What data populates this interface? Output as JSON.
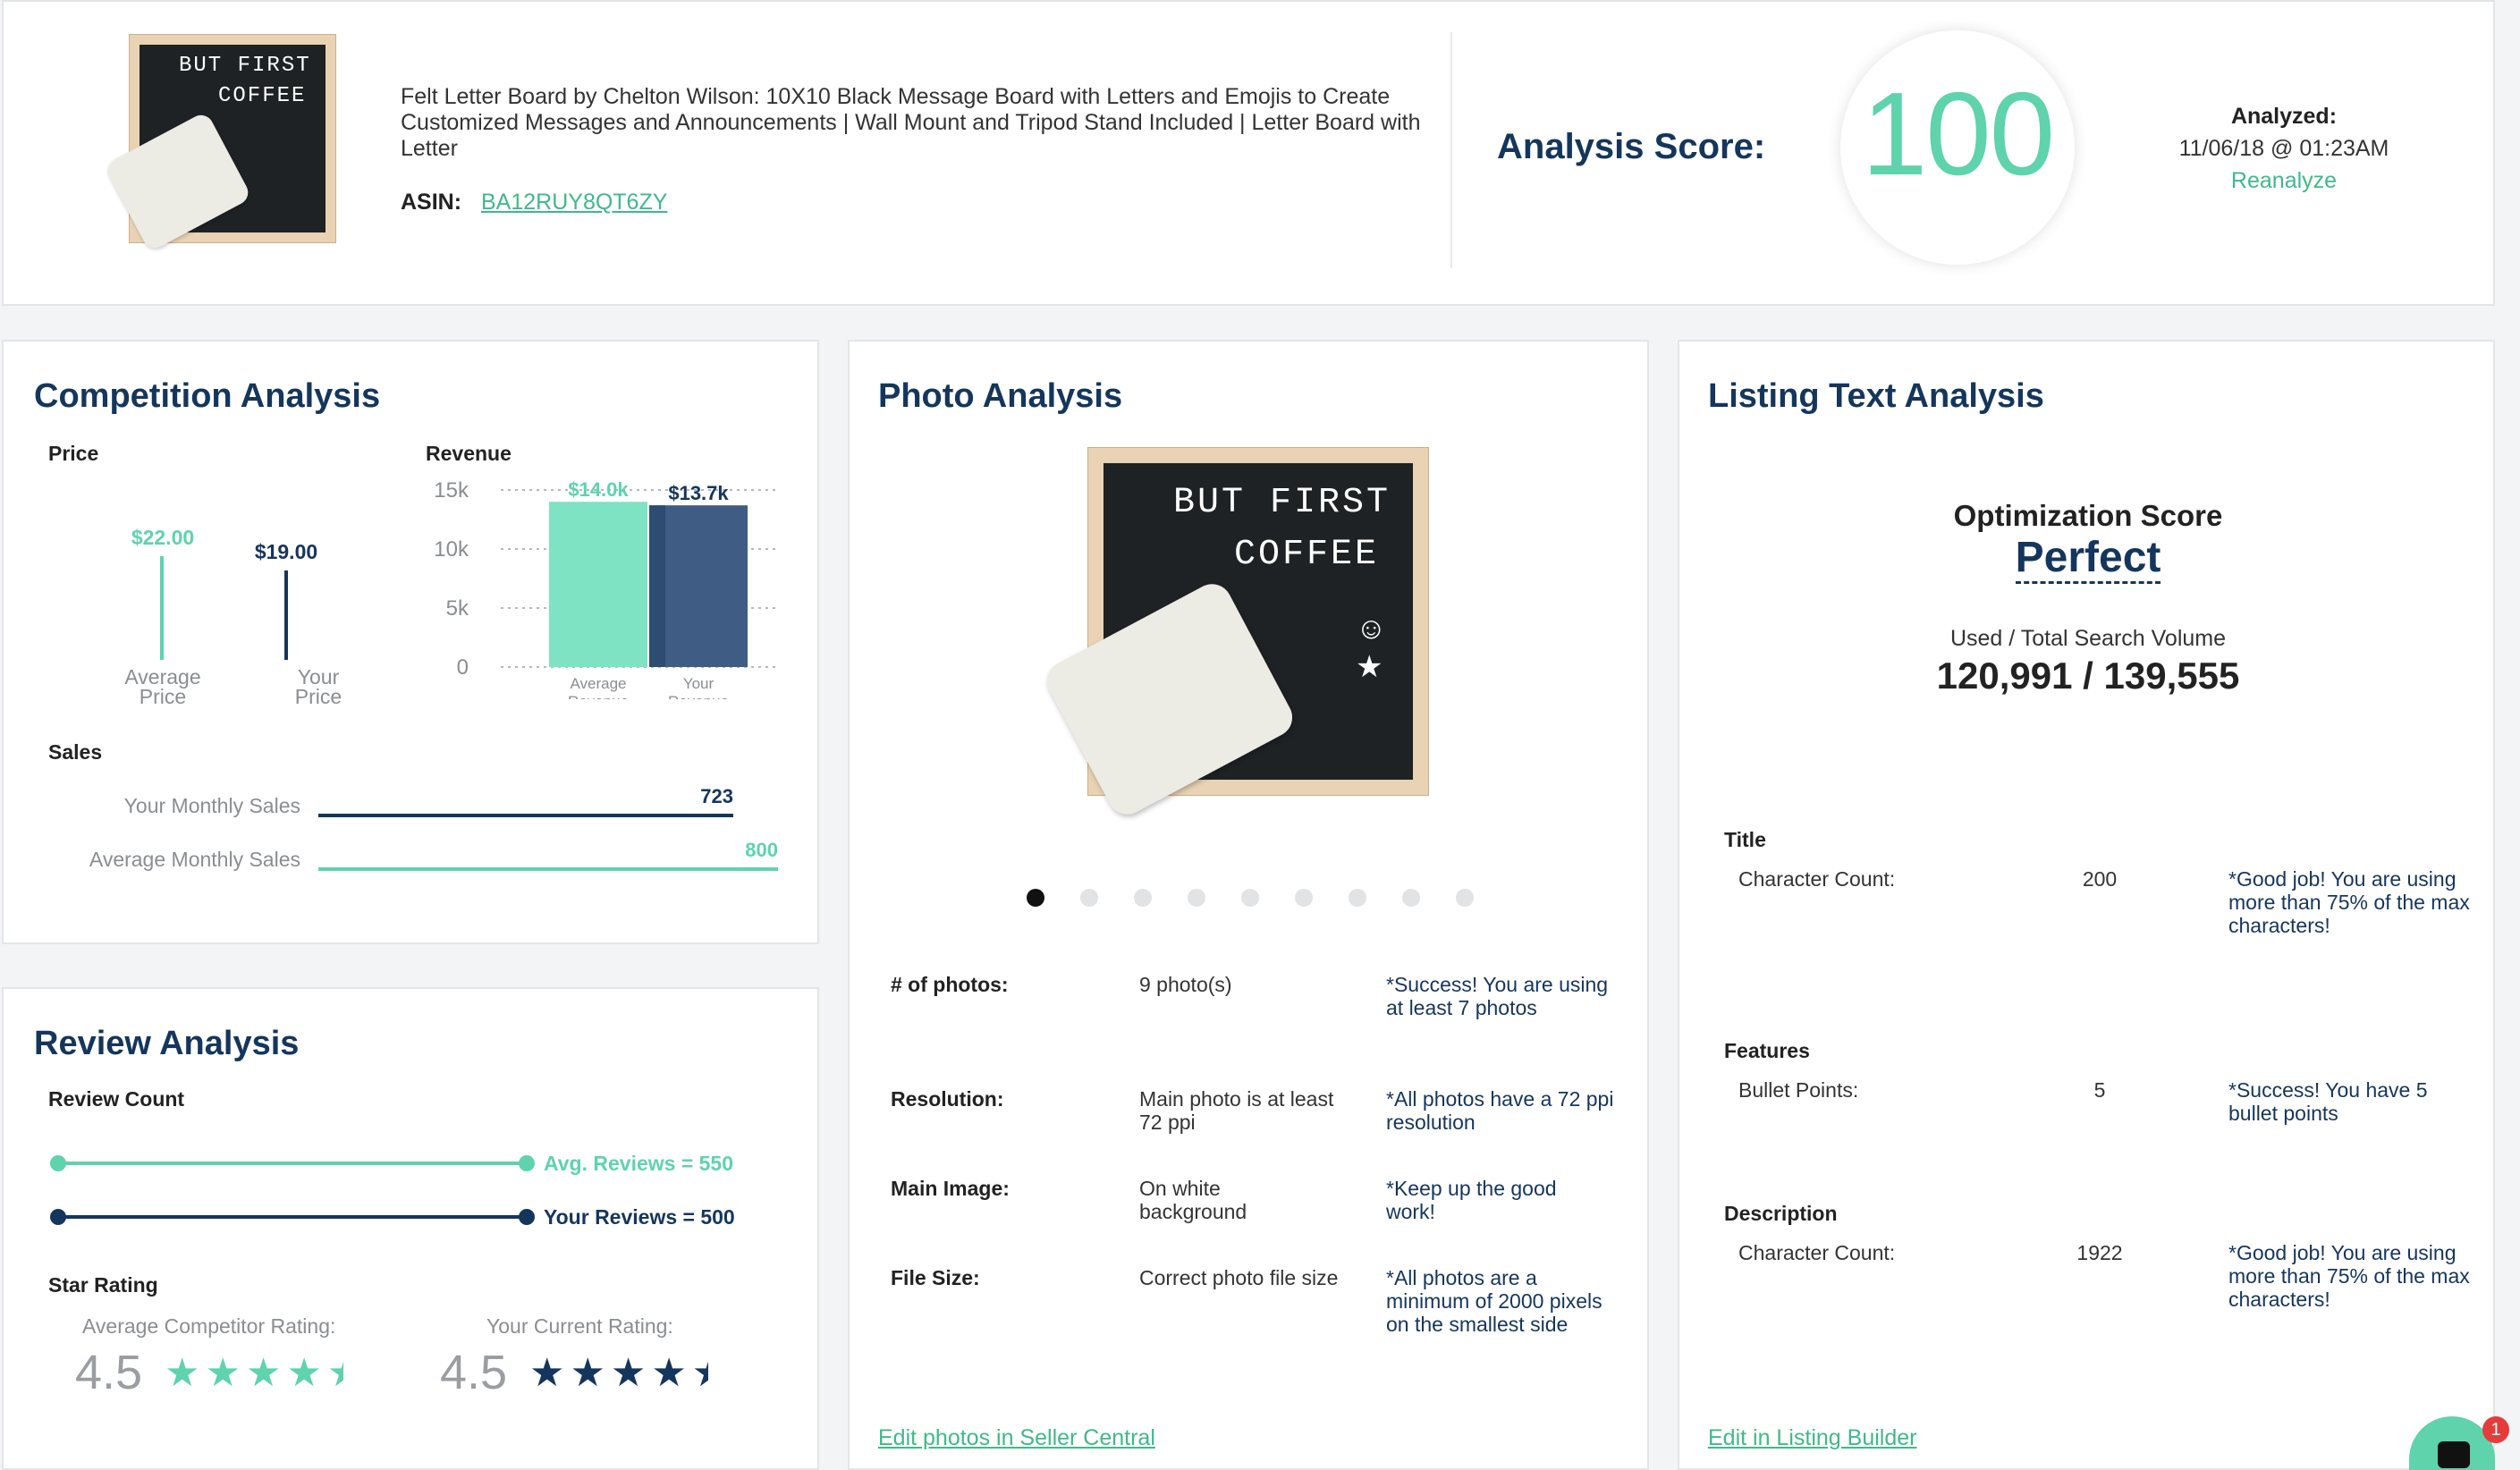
{
  "product": {
    "title": "Felt Letter Board by Chelton Wilson: 10X10 Black Message Board with Letters and Emojis to Create Customized Messages and Announcements | Wall Mount and Tripod Stand Included | Letter Board with Letter",
    "asin_label": "ASIN:",
    "asin": "BA12RUY8QT6ZY",
    "board_text_line1": "BUT FIRST",
    "board_text_line2": "COFFEE"
  },
  "score": {
    "label": "Analysis Score:",
    "value": "100",
    "analyzed_label": "Analyzed:",
    "analyzed_date": "11/06/18 @ 01:23AM",
    "reanalyze": "Reanalyze"
  },
  "competition": {
    "title": "Competition Analysis",
    "price_label": "Price",
    "avg_price_value": "$22.00",
    "avg_price_caption1": "Average",
    "avg_price_caption2": "Price",
    "your_price_value": "$19.00",
    "your_price_caption1": "Your",
    "your_price_caption2": "Price",
    "revenue_label": "Revenue",
    "sales_label": "Sales",
    "your_sales_label": "Your Monthly Sales",
    "your_sales_value": "723",
    "avg_sales_label": "Average Monthly Sales",
    "avg_sales_value": "800"
  },
  "chart_data": {
    "type": "bar",
    "title": "Revenue",
    "categories": [
      "Average Revenue",
      "Your Revenue"
    ],
    "values": [
      14.0,
      13.7
    ],
    "value_labels": [
      "$14.0k",
      "$13.7k"
    ],
    "yticks": [
      "15k",
      "10k",
      "5k",
      "0"
    ],
    "ylim": [
      0,
      15
    ],
    "grid": true,
    "cat_label_avg_1": "Average",
    "cat_label_avg_2": "Revenue",
    "cat_label_your_1": "Your",
    "cat_label_your_2": "Revenue",
    "colors": [
      "#7ee3c3",
      "#3f5c85"
    ]
  },
  "review": {
    "title": "Review Analysis",
    "count_label": "Review Count",
    "avg_reviews": "Avg. Reviews = 550",
    "your_reviews": "Your Reviews = 500",
    "star_label": "Star Rating",
    "avg_rating_label": "Average Competitor Rating:",
    "avg_rating_value": "4.5",
    "your_rating_label": "Your Current Rating:",
    "your_rating_value": "4.5"
  },
  "photo": {
    "title": "Photo Analysis",
    "rows": [
      {
        "label": "# of photos:",
        "value": "9 photo(s)",
        "note": "*Success! You are using at least 7 photos"
      },
      {
        "label": "Resolution:",
        "value": "Main photo is at least 72 ppi",
        "note": "*All photos have a 72 ppi resolution"
      },
      {
        "label": "Main Image:",
        "value": "On white background",
        "note": "*Keep up the good work!"
      },
      {
        "label": "File Size:",
        "value": "Correct photo file size",
        "note": "*All photos are a minimum of 2000 pixels on the smallest side"
      }
    ],
    "edit_link": "Edit photos in Seller Central"
  },
  "listing": {
    "title": "Listing Text Analysis",
    "opt_label": "Optimization Score",
    "opt_value": "Perfect",
    "volume_label": "Used / Total Search Volume",
    "volume_value": "120,991 / 139,555",
    "sections": [
      {
        "title": "Title",
        "label": "Character Count:",
        "value": "200",
        "note": "*Good job! You are using more than 75% of the max characters!"
      },
      {
        "title": "Features",
        "label": "Bullet Points:",
        "value": "5",
        "note": "*Success! You have 5 bullet points"
      },
      {
        "title": "Description",
        "label": "Character Count:",
        "value": "1922",
        "note": "*Good job! You are using more than 75% of the max characters!"
      }
    ],
    "edit_link": "Edit in Listing Builder"
  },
  "chat": {
    "badge": "1"
  }
}
